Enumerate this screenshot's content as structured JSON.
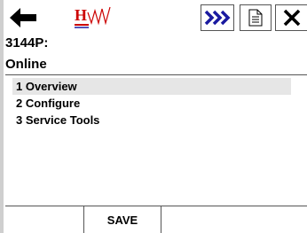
{
  "toolbar": {
    "back_icon": "left-arrow-icon",
    "logo_icon": "hart-logo-icon",
    "forward_icon": "fast-forward-icon",
    "document_icon": "document-icon",
    "close_icon": "close-icon",
    "accent_color": "#1a1aa0",
    "logo_color": "#cc0000"
  },
  "device": {
    "tag": "3144P:",
    "status": "Online"
  },
  "menu": {
    "items": [
      {
        "label": "1 Overview",
        "selected": true
      },
      {
        "label": "2 Configure",
        "selected": false
      },
      {
        "label": "3 Service Tools",
        "selected": false
      }
    ]
  },
  "footer": {
    "save_label": "SAVE"
  }
}
